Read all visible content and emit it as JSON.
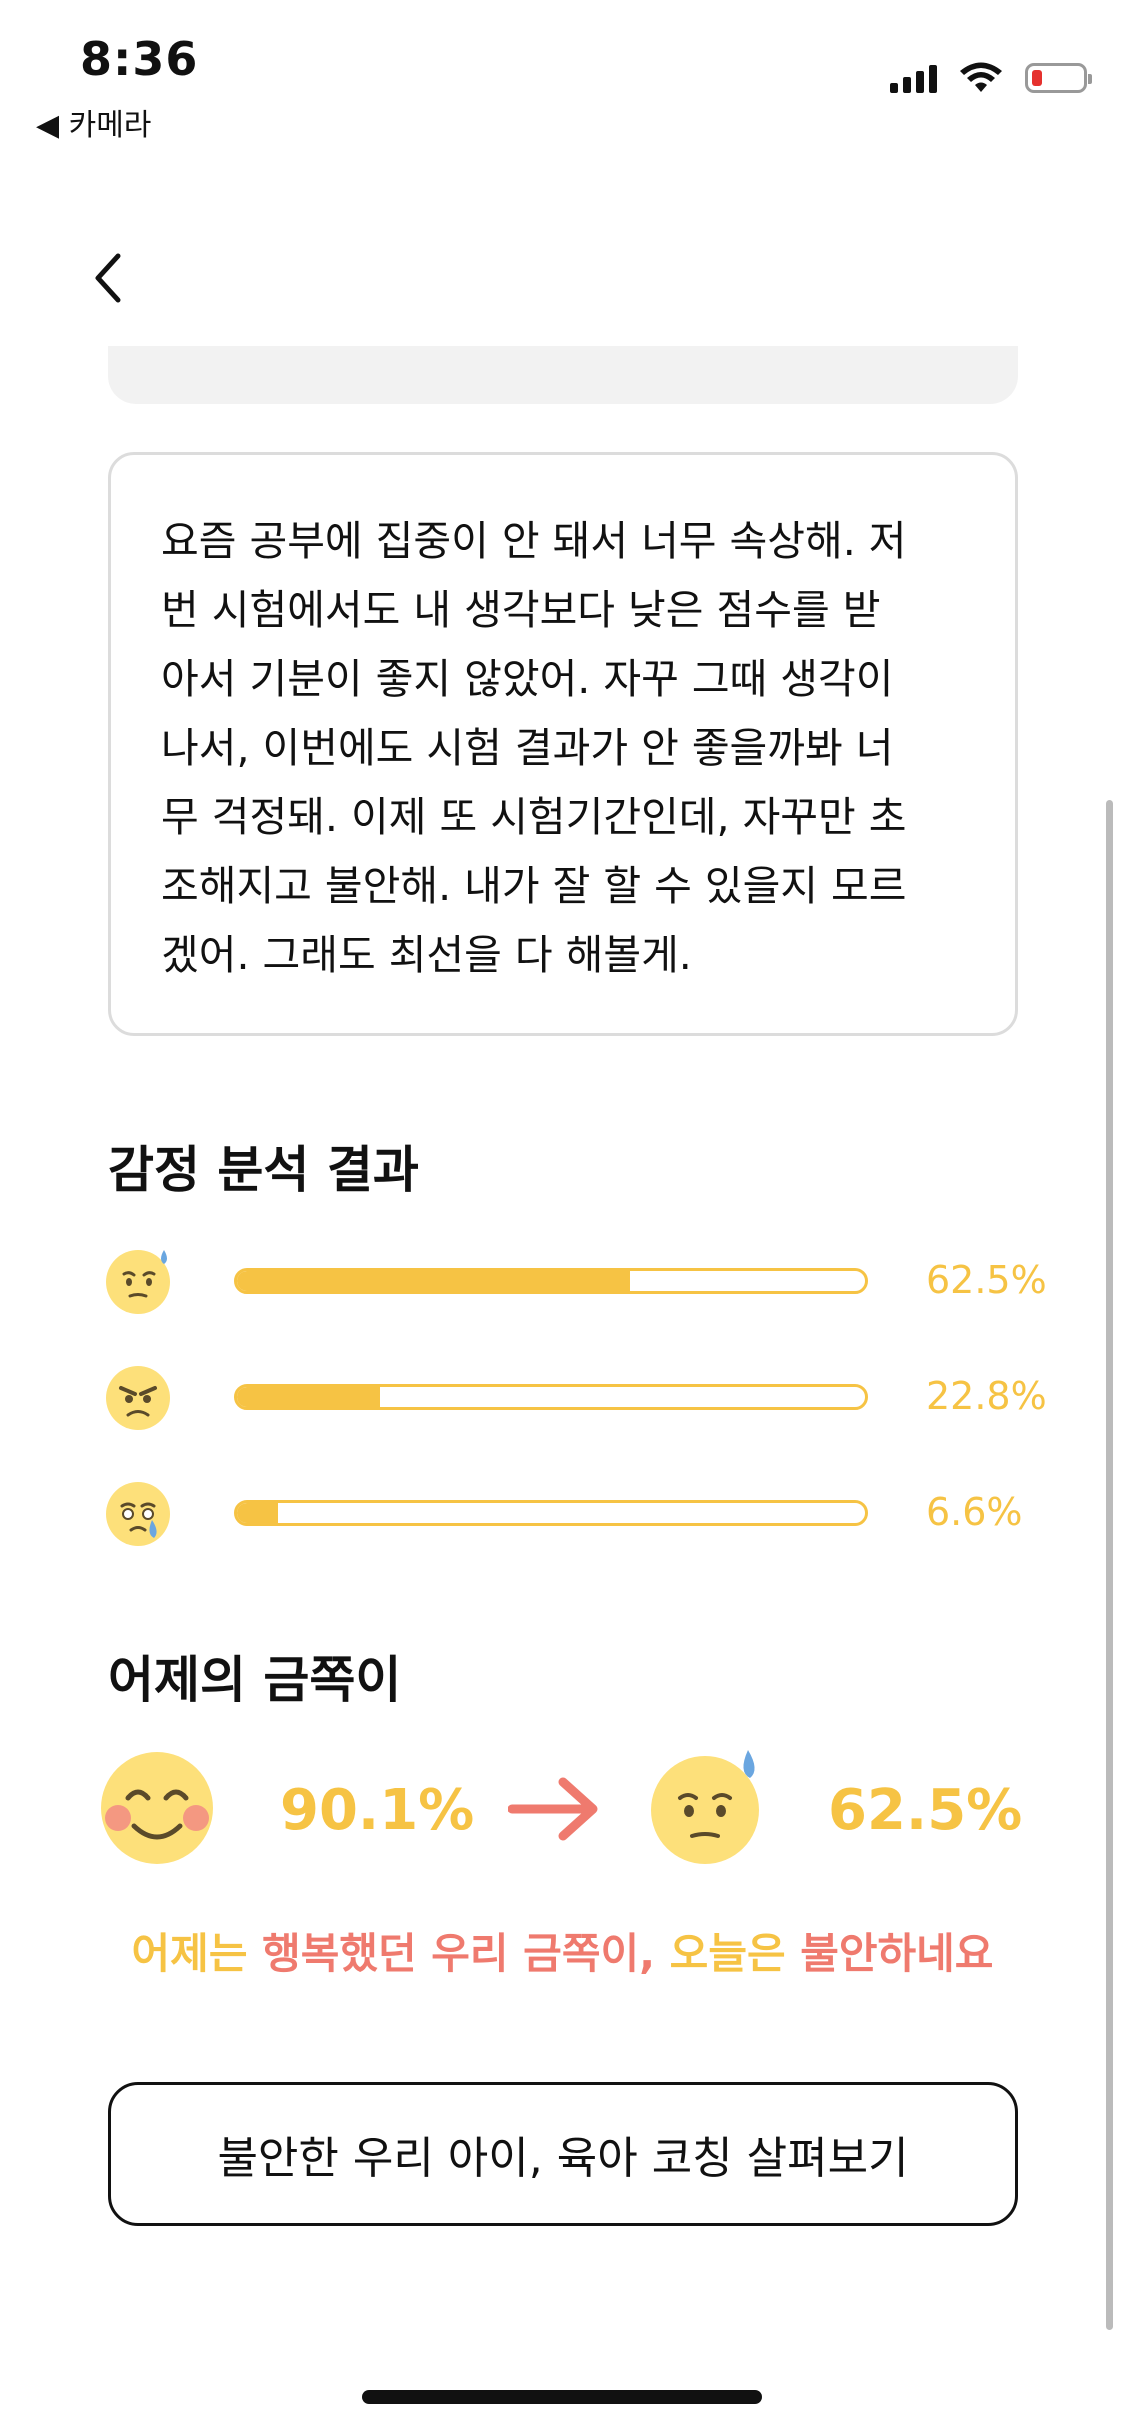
{
  "status_bar": {
    "time": "8:36",
    "back_app_label": "◀ 카메라"
  },
  "diary": {
    "text": "요즘 공부에 집중이 안 돼서 너무 속상해. 저\n번 시험에서도 내 생각보다 낮은 점수를 받\n아서 기분이 좋지 않았어. 자꾸 그때 생각이\n나서, 이번에도 시험 결과가 안 좋을까봐 너\n무 걱정돼. 이제 또 시험기간인데, 자꾸만 초\n조해지고 불안해. 내가 잘 할 수 있을지 모르\n겠어. 그래도 최선을 다 해볼게."
  },
  "emotion_analysis": {
    "title": "감정 분석 결과",
    "items": [
      {
        "emotion_icon": "anxious-sweat-emoji",
        "percent_label": "62.5%",
        "value": 0.625
      },
      {
        "emotion_icon": "angry-emoji",
        "percent_label": "22.8%",
        "value": 0.228
      },
      {
        "emotion_icon": "sad-tear-emoji",
        "percent_label": "6.6%",
        "value": 0.066
      }
    ]
  },
  "yesterday": {
    "title": "어제의 금쪽이",
    "from_icon": "happy-blush-emoji",
    "from_percent": "90.1%",
    "to_icon": "anxious-sweat-emoji",
    "to_percent": "62.5%",
    "summary_part1": "어제는 ",
    "summary_hl1": "행복했던 우리 금쪽이,",
    "summary_part2": " 오늘은 ",
    "summary_hl2": "불안하네요"
  },
  "cta": {
    "label": "불안한 우리 아이, 육아 코칭 살펴보기"
  },
  "colors": {
    "accent_yellow": "#f6c344",
    "accent_coral": "#ef7a6e"
  }
}
